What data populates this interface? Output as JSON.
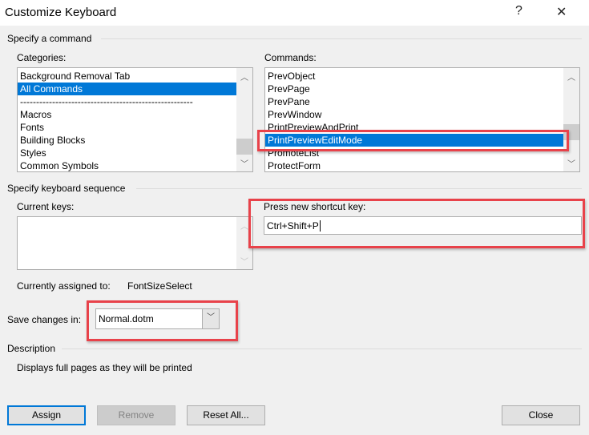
{
  "window": {
    "title": "Customize Keyboard",
    "help_label": "?",
    "close_label": "✕"
  },
  "command_section": {
    "label": "Specify a command",
    "categories": {
      "label": "Categories:",
      "items": [
        "Background Removal Tab",
        "All Commands",
        "------------------------------------------------------",
        "Macros",
        "Fonts",
        "Building Blocks",
        "Styles",
        "Common Symbols"
      ],
      "selected": "All Commands"
    },
    "commands": {
      "label": "Commands:",
      "items": [
        "PrevObject",
        "PrevPage",
        "PrevPane",
        "PrevWindow",
        "PrintPreviewAndPrint",
        "PrintPreviewEditMode",
        "PromoteList",
        "ProtectForm"
      ],
      "selected": "PrintPreviewEditMode"
    }
  },
  "keyboard_section": {
    "label": "Specify keyboard sequence",
    "current_keys_label": "Current keys:",
    "new_key_label": "Press new shortcut key:",
    "new_key_value": "Ctrl+Shift+P",
    "assigned_label": "Currently assigned to:",
    "assigned_value": "FontSizeSelect",
    "save_label": "Save changes in:",
    "save_value": "Normal.dotm"
  },
  "description": {
    "label": "Description",
    "text": "Displays full pages as they will be printed"
  },
  "buttons": {
    "assign": "Assign",
    "remove": "Remove",
    "reset": "Reset All...",
    "close": "Close"
  },
  "colors": {
    "selection": "#0078d7",
    "highlight_box": "#e8424a"
  }
}
